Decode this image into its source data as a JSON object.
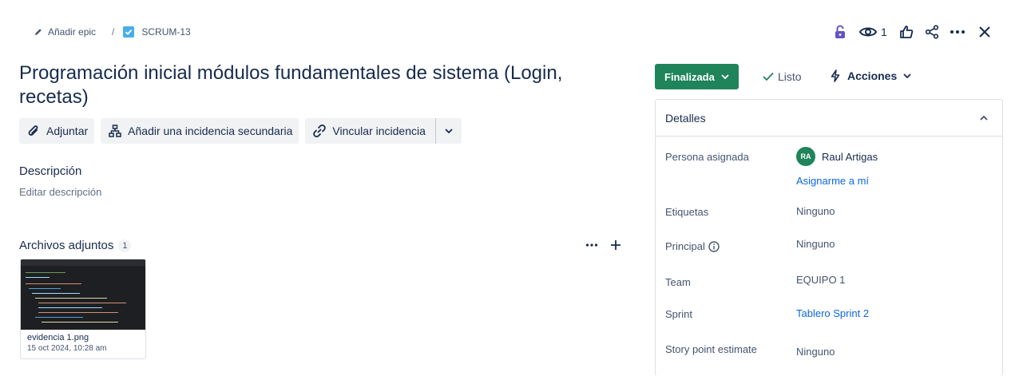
{
  "breadcrumb": {
    "parent_label": "Añadir epic",
    "separator": "/",
    "issue_key": "SCRUM-13"
  },
  "top_actions": {
    "watch_count": "1",
    "icons": [
      "lock-icon",
      "eye-icon",
      "thumbs-up-icon",
      "share-icon",
      "more-icon",
      "close-icon"
    ]
  },
  "issue": {
    "title": "Programación inicial módulos fundamentales de sistema (Login, recetas)"
  },
  "buttons": {
    "attach": "Adjuntar",
    "add_child": "Añadir una incidencia secundaria",
    "link_issue": "Vincular incidencia"
  },
  "description": {
    "heading": "Descripción",
    "placeholder": "Editar descripción"
  },
  "attachments": {
    "heading": "Archivos adjuntos",
    "count": "1",
    "items": [
      {
        "filename": "evidencia 1.png",
        "date": "15 oct 2024, 10:28 am"
      }
    ]
  },
  "status": {
    "label": "Finalizada",
    "resolution": "Listo",
    "actions_label": "Acciones",
    "color": "#1f845a"
  },
  "details": {
    "heading": "Detalles",
    "fields": {
      "assignee_label": "Persona asignada",
      "assignee_initials": "RA",
      "assignee_name": "Raul Artigas",
      "assign_me": "Asignarme a mí",
      "labels_label": "Etiquetas",
      "labels_value": "Ninguno",
      "parent_label": "Principal",
      "parent_value": "Ninguno",
      "team_label": "Team",
      "team_value": "EQUIPO 1",
      "sprint_label": "Sprint",
      "sprint_value": "Tablero Sprint 2",
      "story_points_label": "Story point estimate",
      "story_points_value": "Ninguno"
    }
  },
  "colors": {
    "link": "#0c66e4",
    "text": "#172b4d",
    "accent_lock": "#6554c0"
  }
}
